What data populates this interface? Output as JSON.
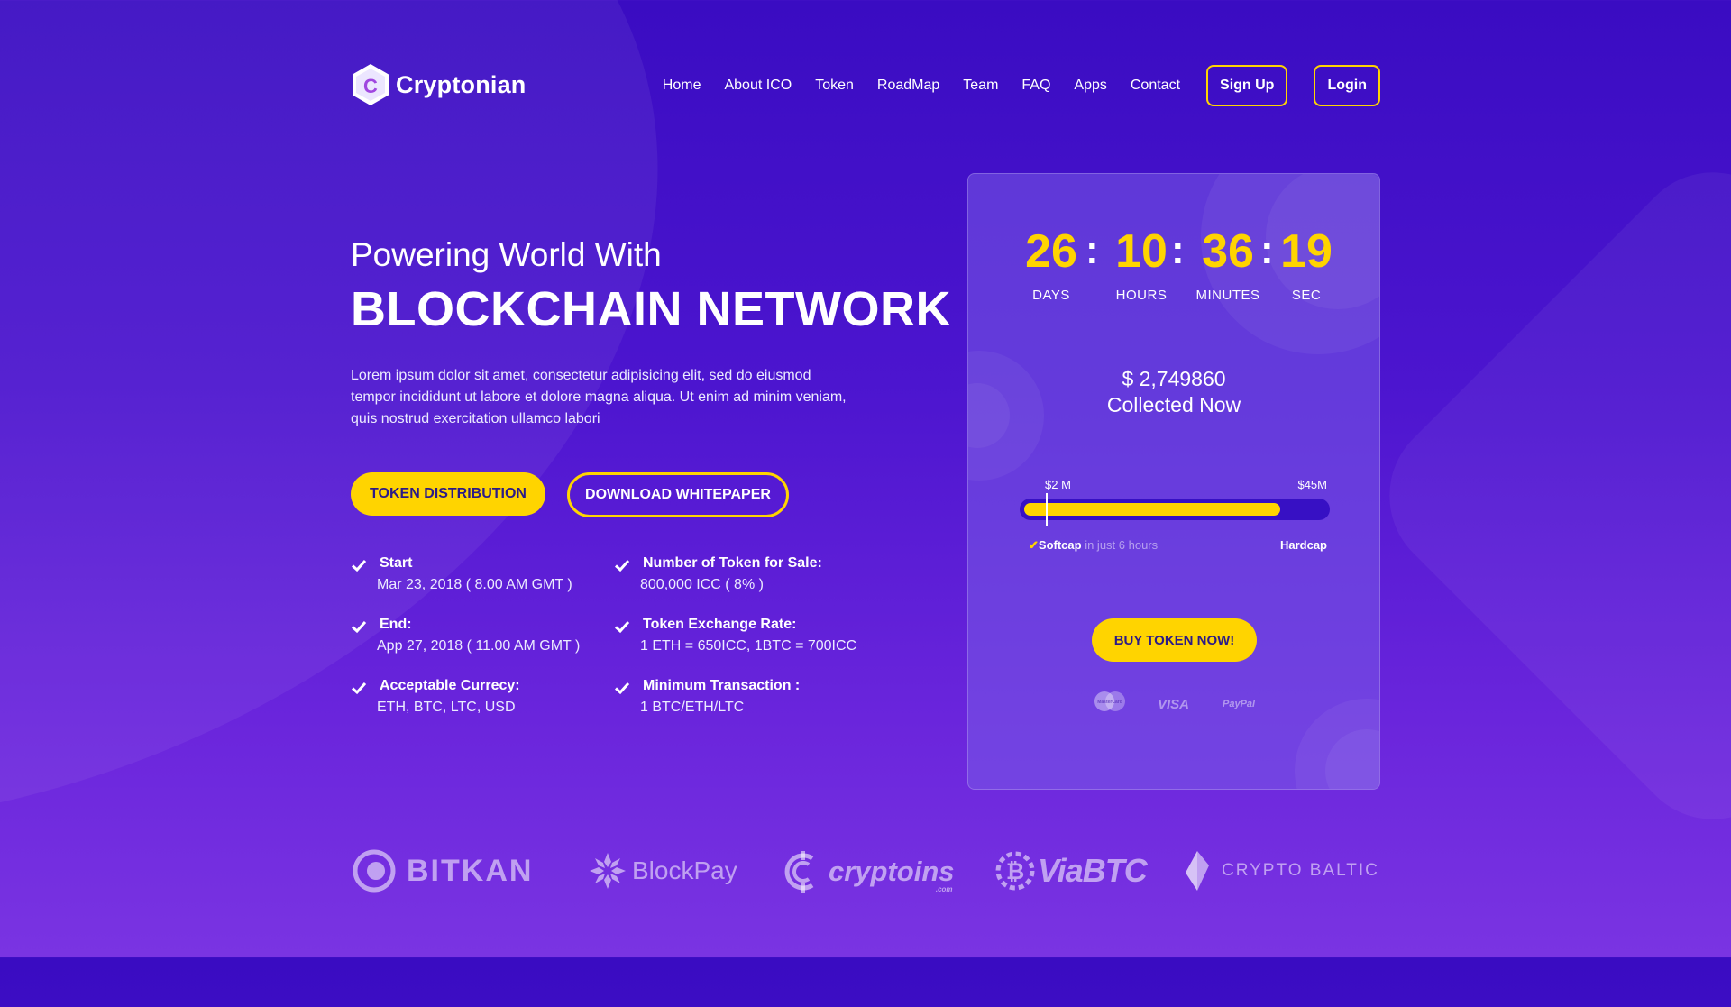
{
  "brand": {
    "name": "Cryptonian",
    "logo_letter": "C"
  },
  "nav": {
    "items": [
      "Home",
      "About ICO",
      "Token",
      "RoadMap",
      "Team",
      "FAQ",
      "Apps",
      "Contact"
    ],
    "signup": "Sign Up",
    "login": "Login"
  },
  "hero": {
    "subtitle": "Powering World With",
    "title": "BLOCKCHAIN NETWORK",
    "description": "Lorem ipsum dolor sit amet, consectetur adipisicing elit, sed do eiusmod tempor incididunt ut labore et dolore magna aliqua. Ut enim ad minim veniam, quis nostrud exercitation ullamco labori",
    "btn_distribution": "TOKEN DISTRIBUTION",
    "btn_whitepaper": "DOWNLOAD WHITEPAPER"
  },
  "info": [
    {
      "label": "Start",
      "value": "Mar 23, 2018 ( 8.00 AM GMT )"
    },
    {
      "label": "End:",
      "value": "App 27, 2018 ( 11.00 AM GMT )"
    },
    {
      "label": "Acceptable Currecy:",
      "value": "ETH, BTC, LTC, USD"
    },
    {
      "label": "Number of Token for Sale:",
      "value": "800,000 ICC ( 8% )"
    },
    {
      "label": "Token Exchange Rate:",
      "value": "1 ETH = 650ICC, 1BTC = 700ICC"
    },
    {
      "label": "Minimum Transaction :",
      "value": "1 BTC/ETH/LTC"
    }
  ],
  "countdown": {
    "days": "26",
    "hours": "10",
    "minutes": "36",
    "seconds": "19",
    "days_label": "DAYS",
    "hours_label": "HOURS",
    "minutes_label": "MINUTES",
    "seconds_label": "SEC",
    "separator": ":"
  },
  "sale": {
    "amount": "$ 2,749860",
    "collected_label": "Collected Now",
    "min_label": "$2 M",
    "max_label": "$45M",
    "progress_fraction": 0.85,
    "softcap": "Softcap",
    "softcap_note": "in just 6 hours",
    "hardcap": "Hardcap",
    "buy_button": "BUY TOKEN NOW!"
  },
  "payments": {
    "mastercard": "MasterCard",
    "visa": "VISA",
    "paypal": "PayPal"
  },
  "partners": {
    "bitkan": "BITKAN",
    "blockpay_a": "Block",
    "blockpay_b": "Pay",
    "cryptoins": "cryptoins",
    "cryptoins_sub": ".com",
    "viabtc": "ViaBTC",
    "cryptobaltic": "CRYPTO BALTIC"
  },
  "colors": {
    "accent": "#ffd400",
    "bg_top": "#3a0cc2",
    "bg_bottom": "#7a34e2"
  }
}
